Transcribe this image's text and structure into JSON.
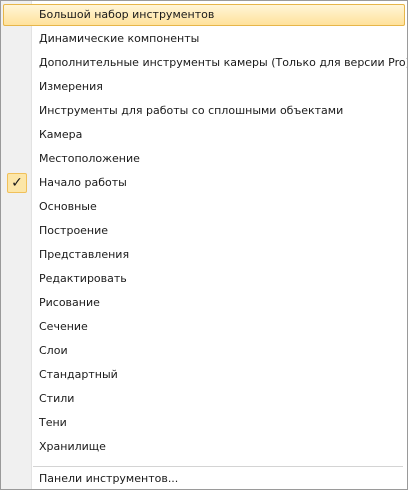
{
  "menu": {
    "items": [
      {
        "label": "Большой набор инструментов",
        "checked": false,
        "highlighted": true
      },
      {
        "label": "Динамические компоненты",
        "checked": false,
        "highlighted": false
      },
      {
        "label": "Дополнительные инструменты камеры (Только для версии Pro)",
        "checked": false,
        "highlighted": false
      },
      {
        "label": "Измерения",
        "checked": false,
        "highlighted": false
      },
      {
        "label": "Инструменты для работы со сплошными объектами",
        "checked": false,
        "highlighted": false
      },
      {
        "label": "Камера",
        "checked": false,
        "highlighted": false
      },
      {
        "label": "Местоположение",
        "checked": false,
        "highlighted": false
      },
      {
        "label": "Начало работы",
        "checked": true,
        "highlighted": false
      },
      {
        "label": "Основные",
        "checked": false,
        "highlighted": false
      },
      {
        "label": "Построение",
        "checked": false,
        "highlighted": false
      },
      {
        "label": "Представления",
        "checked": false,
        "highlighted": false
      },
      {
        "label": "Редактировать",
        "checked": false,
        "highlighted": false
      },
      {
        "label": "Рисование",
        "checked": false,
        "highlighted": false
      },
      {
        "label": "Сечение",
        "checked": false,
        "highlighted": false
      },
      {
        "label": "Слои",
        "checked": false,
        "highlighted": false
      },
      {
        "label": "Стандартный",
        "checked": false,
        "highlighted": false
      },
      {
        "label": "Стили",
        "checked": false,
        "highlighted": false
      },
      {
        "label": "Тени",
        "checked": false,
        "highlighted": false
      },
      {
        "label": "Хранилище",
        "checked": false,
        "highlighted": false
      }
    ],
    "footer_item": {
      "label": "Панели инструментов..."
    },
    "check_glyph": "✓",
    "colors": {
      "highlight_fill": "#ffe29b",
      "highlight_border": "#e7b649",
      "check_fill": "#fce6a8",
      "gutter": "#f0f0f0"
    }
  }
}
